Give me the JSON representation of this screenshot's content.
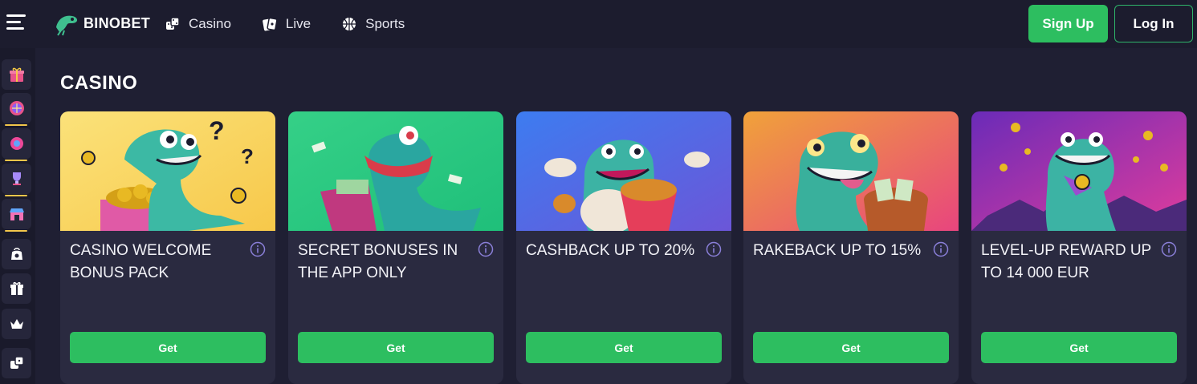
{
  "header": {
    "logo_text": "BINOBET",
    "nav": [
      {
        "label": "Casino",
        "icon": "dice-icon"
      },
      {
        "label": "Live",
        "icon": "cards-icon"
      },
      {
        "label": "Sports",
        "icon": "basketball-icon"
      }
    ],
    "signup_label": "Sign Up",
    "login_label": "Log In"
  },
  "rail": {
    "items": [
      {
        "icon": "gift-box-icon"
      },
      {
        "icon": "wheel-icon"
      },
      {
        "icon": "slot-icon"
      },
      {
        "icon": "trophy-icon"
      },
      {
        "icon": "shop-icon"
      },
      {
        "icon": "bag-icon"
      },
      {
        "icon": "gift-icon"
      },
      {
        "icon": "crown-icon"
      },
      {
        "icon": "dice-icon"
      }
    ]
  },
  "main": {
    "section_title": "CASINO",
    "cards": [
      {
        "title": "CASINO WELCOME BONUS PACK",
        "button": "Get",
        "bg_from": "#f7c84a",
        "bg_to": "#fbe27a"
      },
      {
        "title": "SECRET BONUSES IN THE APP ONLY",
        "button": "Get",
        "bg_from": "#1fbf7a",
        "bg_to": "#35d087"
      },
      {
        "title": "CASHBACK UP TO 20%",
        "button": "Get",
        "bg_from": "#3d7cf0",
        "bg_to": "#6b56d8"
      },
      {
        "title": "RAKEBACK UP TO 15%",
        "button": "Get",
        "bg_from": "#f0a23a",
        "bg_to": "#e8457e"
      },
      {
        "title": "LEVEL-UP REWARD UP TO 14 000 EUR",
        "button": "Get",
        "bg_from": "#6a2bb8",
        "bg_to": "#e03c9c"
      }
    ]
  },
  "colors": {
    "accent_green": "#2dbe60",
    "page_bg": "#1f1f33",
    "card_bg": "#2a2a40",
    "info_icon": "#8a7fd8"
  }
}
